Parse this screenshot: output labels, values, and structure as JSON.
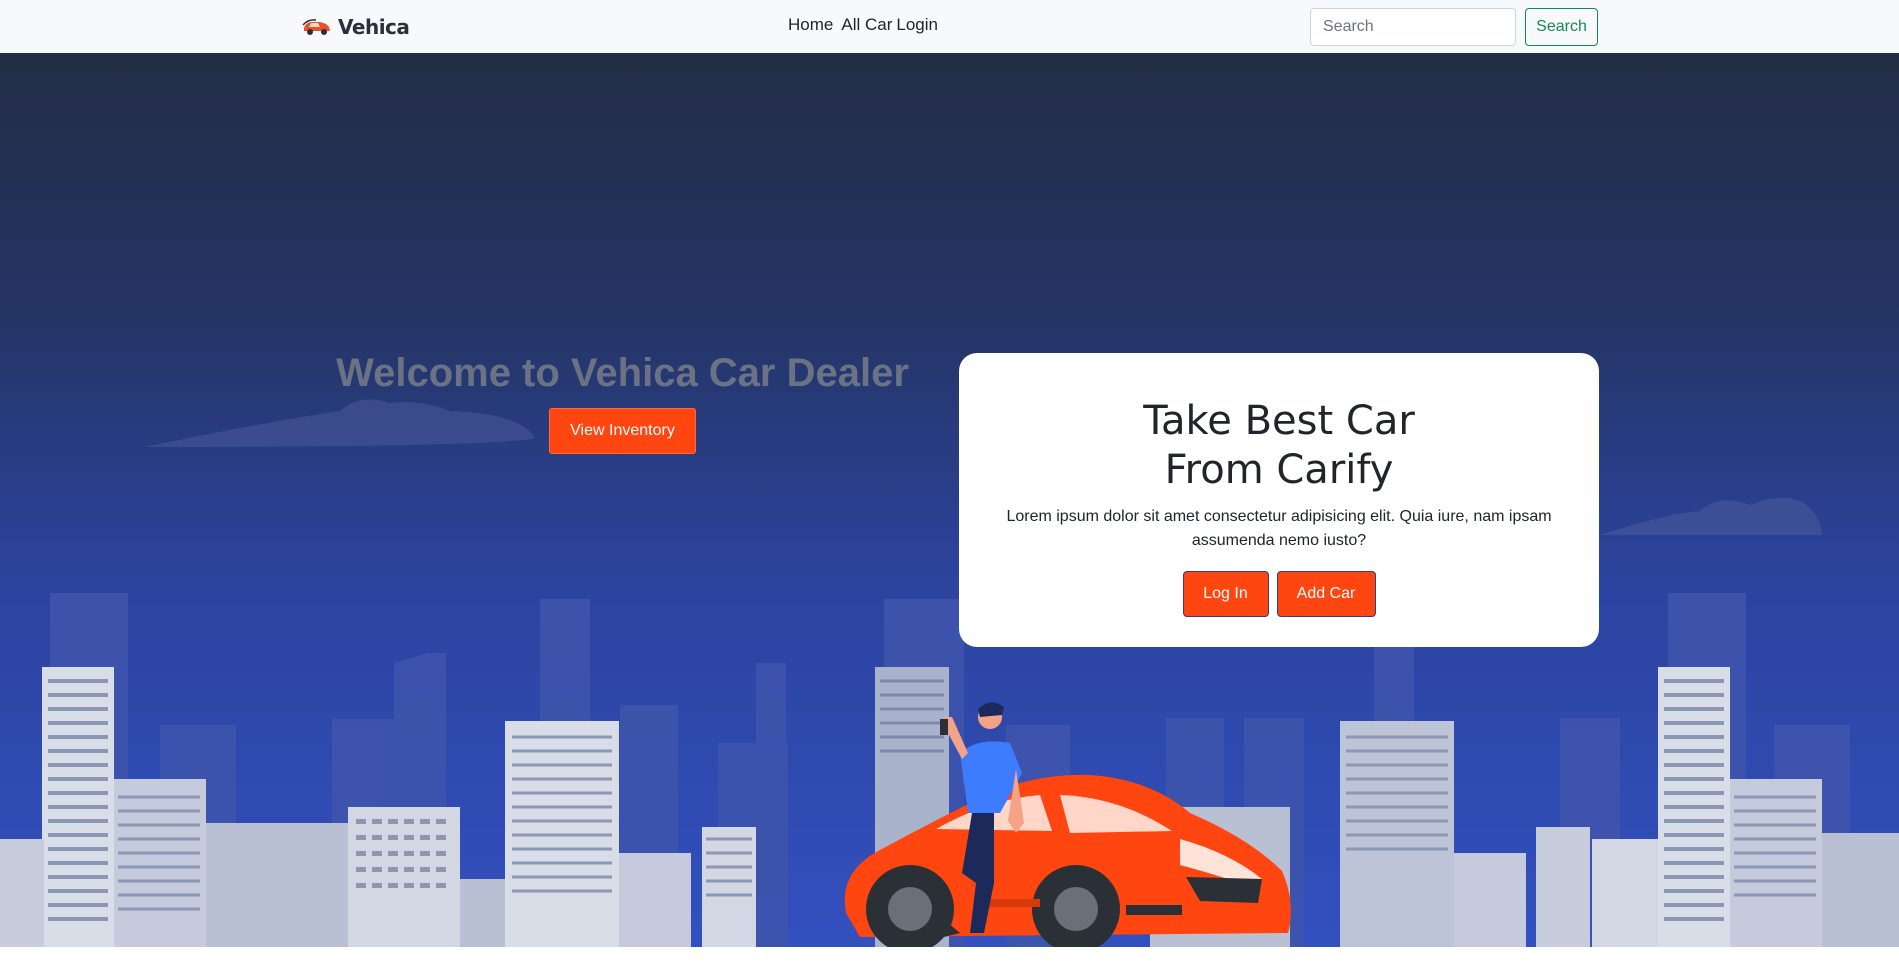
{
  "navbar": {
    "brand": "Vehica",
    "links": [
      "Home",
      "All Car",
      "Login"
    ],
    "search_placeholder": "Search",
    "search_button": "Search"
  },
  "hero": {
    "welcome": "Welcome to Vehica Car Dealer",
    "view_inventory": "View Inventory"
  },
  "card": {
    "title_line1": "Take Best Car",
    "title_line2": "From Carify",
    "text": "Lorem ipsum dolor sit amet consectetur adipisicing elit. Quia iure, nam ipsam assumenda nemo iusto?",
    "login_button": "Log In",
    "add_car_button": "Add Car"
  },
  "colors": {
    "accent": "#ff4510",
    "search_green": "#198754",
    "hero_top": "#232d45",
    "hero_bottom": "#3250bf"
  }
}
